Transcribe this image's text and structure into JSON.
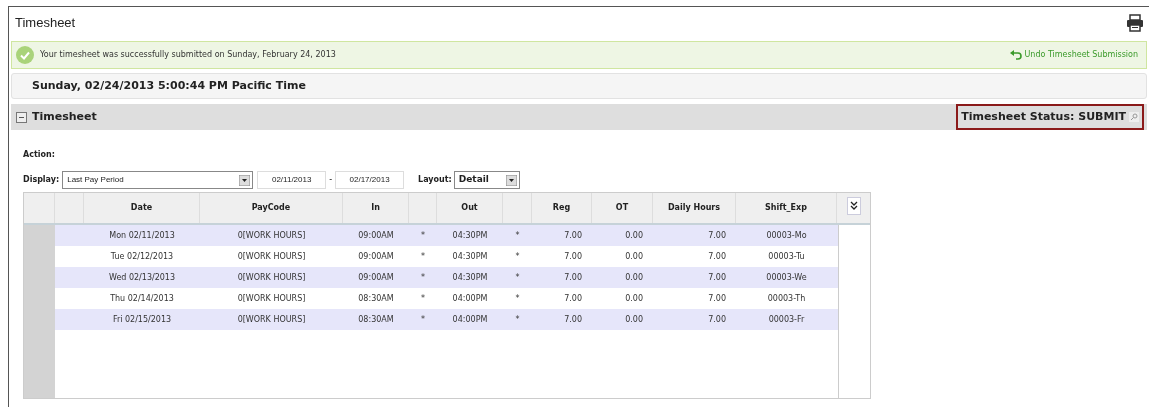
{
  "page_title": "Timesheet",
  "notice": {
    "message": "Your timesheet was successfully submitted on Sunday, February 24, 2013",
    "action": "Undo Timesheet Submission"
  },
  "datetime": "Sunday, 02/24/2013 5:00:44 PM Pacific Time",
  "section": {
    "title": "Timesheet",
    "expanded": true,
    "status": "Timesheet Status: SUBMIT"
  },
  "action_label": "Action:",
  "display": {
    "label": "Display:",
    "value": "Last Pay Period",
    "start": "02/11/2013",
    "separator": "-",
    "end": "02/17/2013"
  },
  "layout": {
    "label": "Layout:",
    "value": "Detail"
  },
  "table": {
    "columns": [
      "",
      "",
      "Date",
      "PayCode",
      "In",
      "",
      "Out",
      "",
      "Reg",
      "OT",
      "Daily Hours",
      "Shift_Exp"
    ],
    "rows": [
      [
        "",
        "",
        "Mon 02/11/2013",
        "0[WORK HOURS]",
        "09:00AM",
        "*",
        "04:30PM",
        "*",
        "7.00",
        "0.00",
        "7.00",
        "00003-Mo"
      ],
      [
        "",
        "",
        "Tue 02/12/2013",
        "0[WORK HOURS]",
        "09:00AM",
        "*",
        "04:30PM",
        "*",
        "7.00",
        "0.00",
        "7.00",
        "00003-Tu"
      ],
      [
        "",
        "",
        "Wed 02/13/2013",
        "0[WORK HOURS]",
        "09:00AM",
        "*",
        "04:30PM",
        "*",
        "7.00",
        "0.00",
        "7.00",
        "00003-We"
      ],
      [
        "",
        "",
        "Thu 02/14/2013",
        "0[WORK HOURS]",
        "08:30AM",
        "*",
        "04:00PM",
        "*",
        "7.00",
        "0.00",
        "7.00",
        "00003-Th"
      ],
      [
        "",
        "",
        "Fri 02/15/2013",
        "0[WORK HOURS]",
        "08:30AM",
        "*",
        "04:00PM",
        "*",
        "7.00",
        "0.00",
        "7.00",
        "00003-Fr"
      ]
    ]
  }
}
